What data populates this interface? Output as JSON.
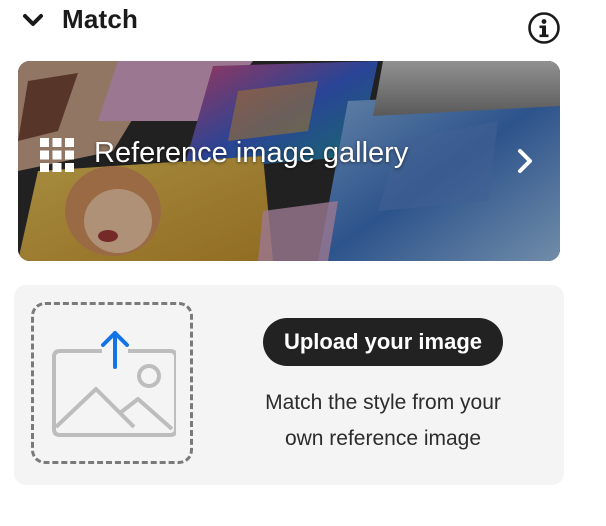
{
  "section": {
    "title": "Match",
    "collapse_icon": "chevron-down-icon",
    "info_icon": "info-icon"
  },
  "gallery": {
    "label": "Reference image gallery",
    "grid_icon": "grid-icon",
    "arrow_icon": "chevron-right-icon"
  },
  "upload": {
    "button_label": "Upload your image",
    "description_line1": "Match the style from your",
    "description_line2": "own reference image",
    "placeholder_icon": "image-upload-icon",
    "accent_color": "#1473e6"
  }
}
